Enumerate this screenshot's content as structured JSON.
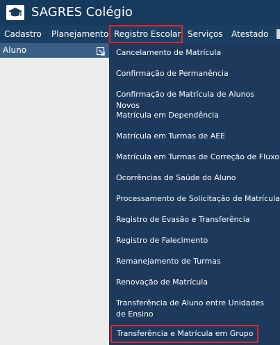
{
  "app": {
    "title": "SAGRES Colégio"
  },
  "menu": {
    "items": [
      {
        "label": "Cadastro"
      },
      {
        "label": "Planejamento"
      },
      {
        "label": "Registro Escolar"
      },
      {
        "label": "Serviços"
      },
      {
        "label": "Atestado"
      }
    ],
    "active_label": "Registro Escolar"
  },
  "panel": {
    "title": "Aluno"
  },
  "dropdown": {
    "items": [
      {
        "label": "Cancelamento de Matrícula"
      },
      {
        "label": "Confirmação de Permanência"
      },
      {
        "label": "Confirmação de Matrícula de Alunos Novos"
      },
      {
        "label": "Matrícula em Dependência"
      },
      {
        "label": "Matrícula em Turmas de AEE"
      },
      {
        "label": "Matrícula em Turmas de Correção de Fluxo"
      },
      {
        "label": "Ocorrências de Saúde do Aluno"
      },
      {
        "label": "Processamento de Solicitação de Matrícula"
      },
      {
        "label": "Registro de Evasão e Transferência"
      },
      {
        "label": "Registro de Falecimento"
      },
      {
        "label": "Remanejamento de Turmas"
      },
      {
        "label": "Renovação de Matrícula"
      },
      {
        "label": "Transferência de Aluno entre Unidades de Ensino"
      },
      {
        "label": "Transferência e Matrícula em Grupo"
      }
    ],
    "highlighted_label": "Transferência e Matrícula em Grupo"
  },
  "colors": {
    "titlebar": "#163a5c",
    "menubar": "#1b3f63",
    "dropdown": "#1d3a5c",
    "panel_header": "#3a5f86",
    "highlight_border": "#e8202a"
  }
}
